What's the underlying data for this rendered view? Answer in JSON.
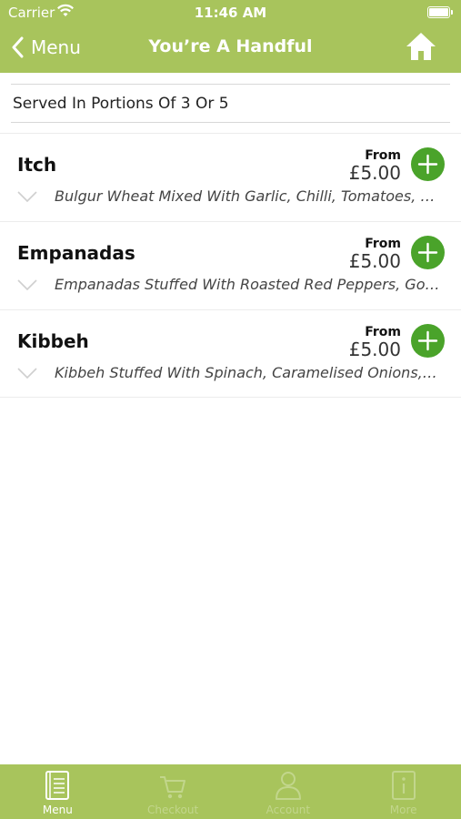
{
  "status_bar": {
    "carrier": "Carrier",
    "time": "11:46 AM"
  },
  "nav": {
    "back_label": "Menu",
    "title": "You’re A Handful"
  },
  "section": {
    "header": "Served In Portions Of 3 Or 5"
  },
  "items": [
    {
      "name": "Itch",
      "from_label": "From",
      "price": "£5.00",
      "description": "Bulgur Wheat Mixed With Garlic, Chilli, Tomatoes, Parsley"
    },
    {
      "name": "Empanadas",
      "from_label": "From",
      "price": "£5.00",
      "description": "Empanadas Stuffed With Roasted Red Peppers, Goats Cheese"
    },
    {
      "name": "Kibbeh",
      "from_label": "From",
      "price": "£5.00",
      "description": "Kibbeh Stuffed With Spinach, Caramelised Onions, Pine Nuts"
    }
  ],
  "tabs": [
    {
      "label": "Menu",
      "icon": "menu-book-icon",
      "active": true
    },
    {
      "label": "Checkout",
      "icon": "cart-icon",
      "active": false
    },
    {
      "label": "Account",
      "icon": "person-icon",
      "active": false
    },
    {
      "label": "More",
      "icon": "info-icon",
      "active": false
    }
  ],
  "colors": {
    "brand": "#a8c45c",
    "add_button": "#4aa32a",
    "inactive_tab": "#c2d68c"
  }
}
